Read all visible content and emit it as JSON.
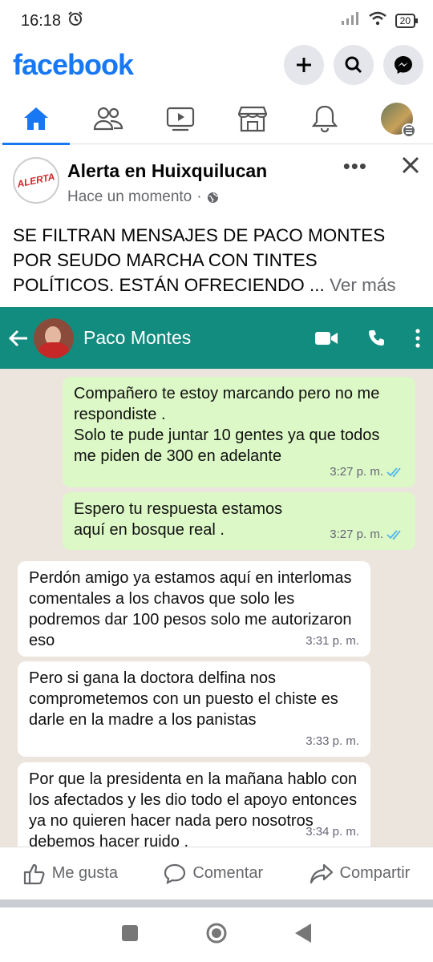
{
  "status": {
    "time": "16:18",
    "battery": "20"
  },
  "header": {
    "logo": "facebook",
    "actions": [
      "plus-icon",
      "search-icon",
      "messenger-icon"
    ]
  },
  "nav": {
    "tabs": [
      "home-icon",
      "friends-icon",
      "watch-icon",
      "marketplace-icon",
      "notifications-icon",
      "profile-avatar"
    ],
    "active": "home"
  },
  "post": {
    "page_name": "Alerta en Huixquilucan",
    "avatar_text": "ALERTA",
    "time": "Hace un momento",
    "text": "SE FILTRAN MENSAJES DE PACO MONTES POR SEUDO MARCHA CON TINTES POLÍTICOS. ESTÁN OFRECIENDO ...",
    "see_more": "Ver más"
  },
  "chat": {
    "contact_name": "Paco Montes",
    "messages": [
      {
        "dir": "out",
        "text": "Compañero te estoy marcando pero no me respondiste .\nSolo te pude juntar 10 gentes ya que todos me piden de 300 en adelante",
        "time": "3:27 p. m."
      },
      {
        "dir": "out",
        "text": "Espero tu respuesta estamos aquí en bosque real .",
        "time": "3:27 p. m."
      },
      {
        "dir": "in",
        "text": "Perdón amigo ya estamos aquí en interlomas comentales a los chavos que solo les podremos dar 100 pesos solo me autorizaron eso",
        "time": "3:31 p. m."
      },
      {
        "dir": "in",
        "text": "Pero si gana la doctora delfina nos comprometemos con un puesto el chiste es darle en la madre a los panistas",
        "time": "3:33 p. m."
      },
      {
        "dir": "in",
        "text": "Por que la presidenta en la mañana hablo con los afectados y les dio todo el apoyo entonces ya no quieren hacer nada pero nosotros debemos hacer ruido .",
        "time": "3:34 p. m."
      }
    ]
  },
  "actions": {
    "like": "Me gusta",
    "comment": "Comentar",
    "share": "Compartir"
  },
  "colors": {
    "facebook_blue": "#1877f2",
    "whatsapp_teal": "#128c7e",
    "outgoing_bubble": "#dcf8c6",
    "chat_bg": "#ece5dd"
  }
}
